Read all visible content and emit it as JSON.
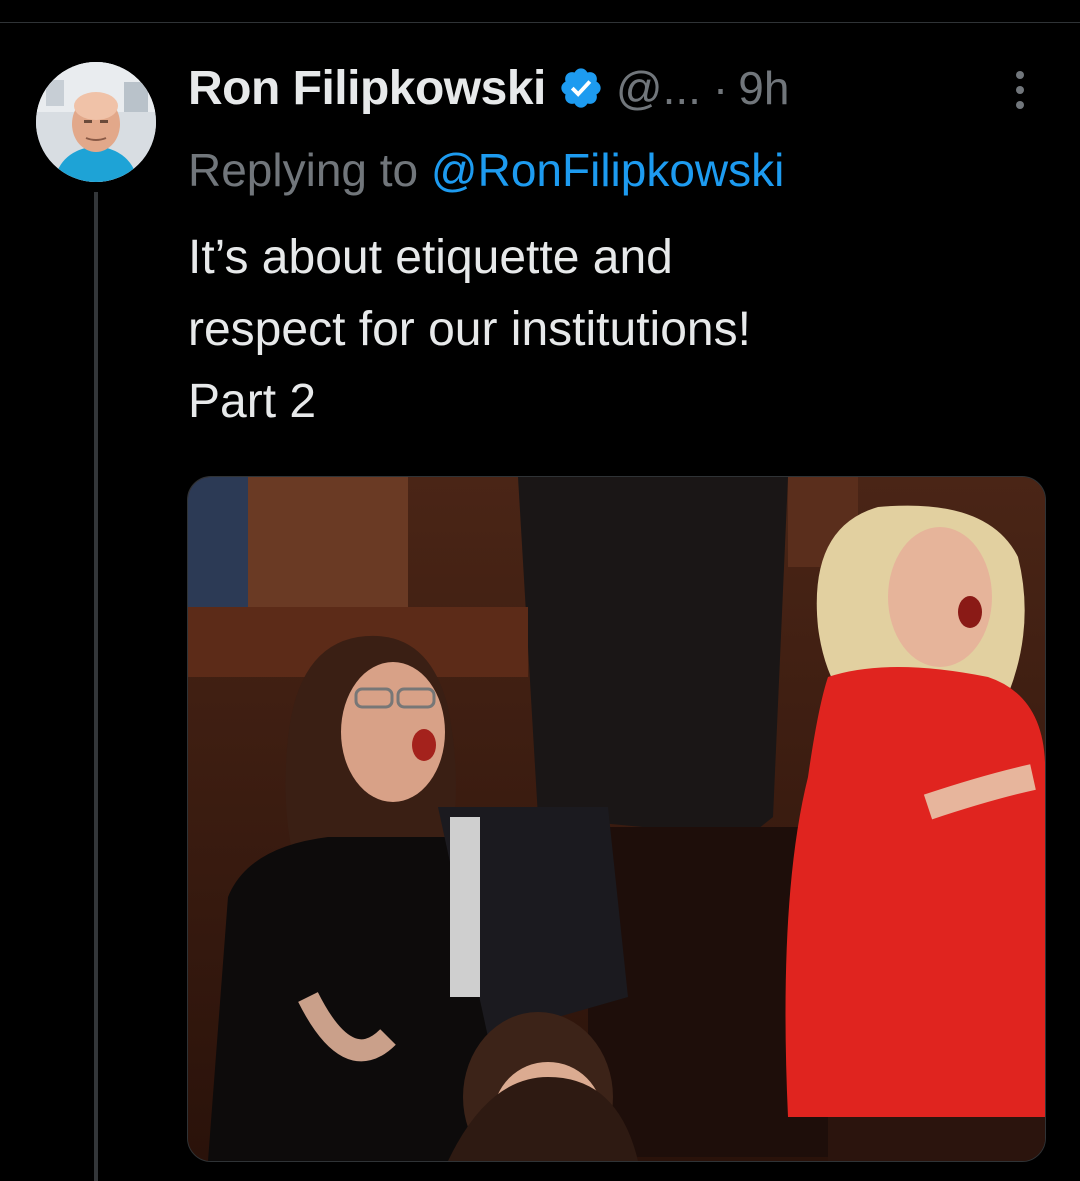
{
  "tweet": {
    "author_name": "Ron Filipkowski",
    "handle": "@...",
    "separator": "·",
    "timestamp": "9h",
    "reply_prefix": "Replying to",
    "reply_handle": "@RonFilipkowski",
    "text": "It’s about etiquette and\nrespect for our institutions!\nPart 2",
    "verified": true
  },
  "icons": {
    "verified": "verified-badge-icon",
    "more": "more-vertical-icon"
  },
  "colors": {
    "background": "#000000",
    "text_primary": "#e7e9ea",
    "text_secondary": "#71767b",
    "accent": "#1d9bf0"
  }
}
